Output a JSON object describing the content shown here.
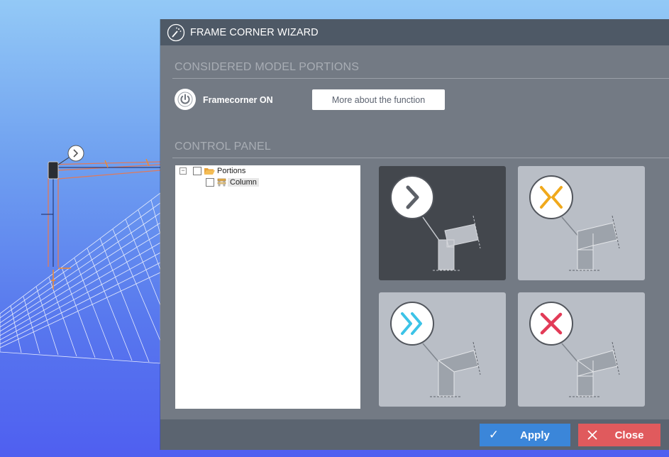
{
  "window": {
    "title": "FRAME CORNER WIZARD",
    "title_icon": "wizard-wand-icon"
  },
  "sections": {
    "model_portions": "CONSIDERED MODEL PORTIONS",
    "control_panel": "CONTROL PANEL"
  },
  "framecorner": {
    "label": "Framecorner ON",
    "state": "on",
    "icon": "power-icon"
  },
  "more_button": "More about the function",
  "tree": {
    "root": {
      "label": "Portions",
      "expander": "−",
      "icon": "folder-open-icon",
      "checked": false
    },
    "children": [
      {
        "label": "Column",
        "icon": "column-portion-icon",
        "checked": false,
        "selected": true
      }
    ]
  },
  "options": [
    {
      "name": "next",
      "icon": "chevron-right-icon",
      "icon_color": "#5d6168",
      "selected": true
    },
    {
      "name": "shorten",
      "icon": "converge-arrows-icon",
      "icon_color": "#f0a91c",
      "selected": false
    },
    {
      "name": "extend",
      "icon": "double-chevron-right-icon",
      "icon_color": "#3cc3e7",
      "selected": false
    },
    {
      "name": "remove",
      "icon": "x-icon",
      "icon_color": "#e23b57",
      "selected": false
    }
  ],
  "footer": {
    "apply": {
      "label": "Apply",
      "icon": "check-icon"
    },
    "close": {
      "label": "Close",
      "icon": "close-icon"
    }
  },
  "colors": {
    "titlebar": "#4e5966",
    "panel": "#737a84",
    "apply": "#3b86d9",
    "close": "#e05a5d"
  }
}
